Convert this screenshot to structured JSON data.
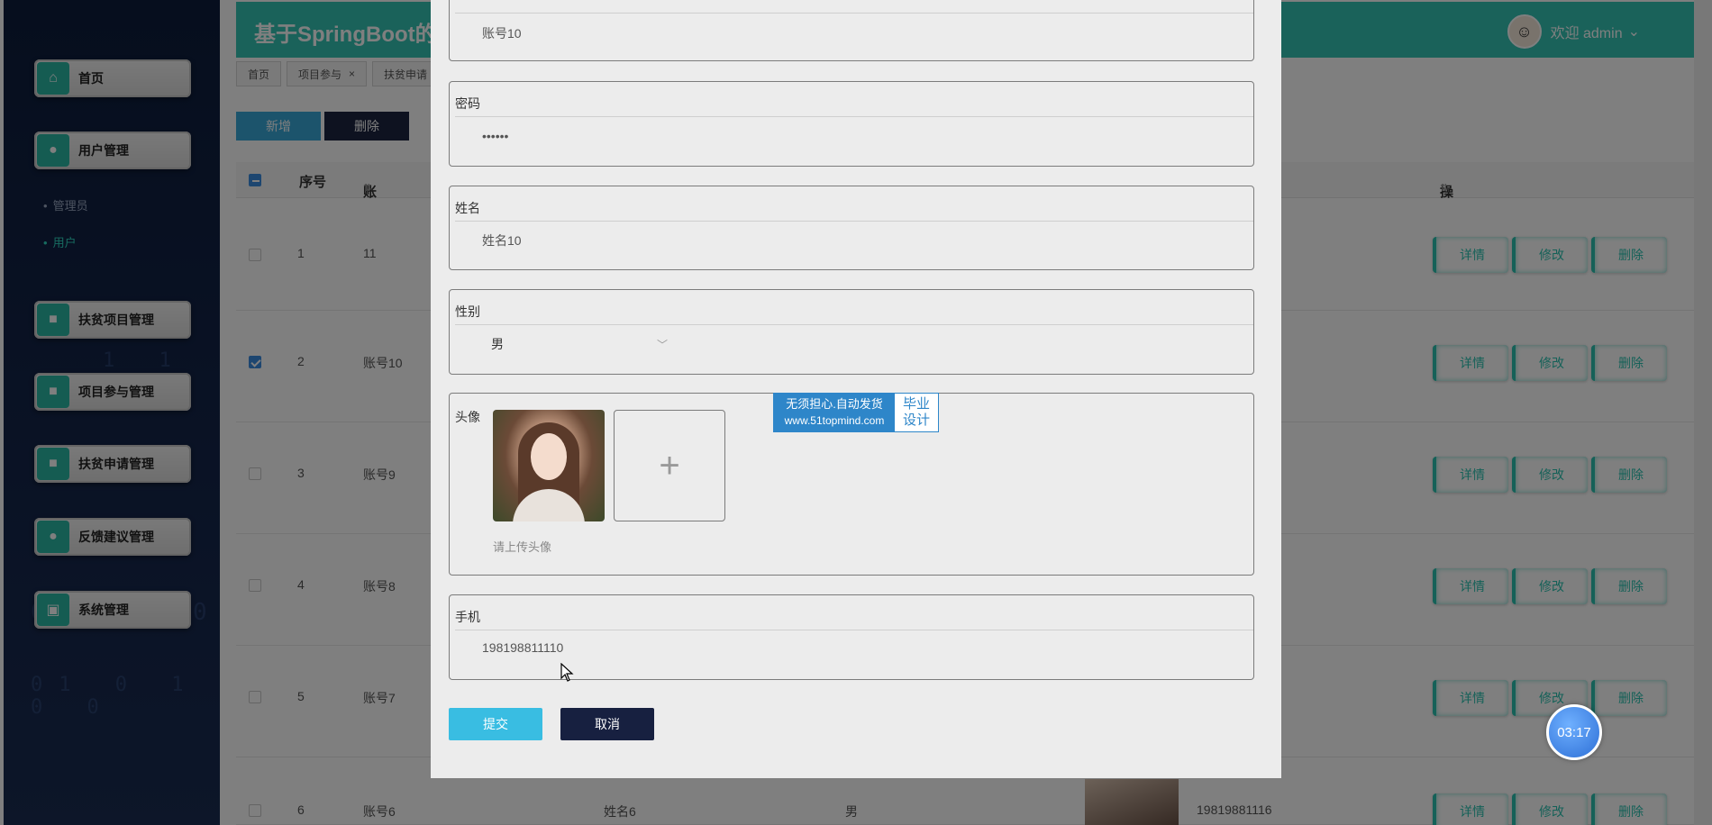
{
  "app": {
    "title": "基于SpringBoot的",
    "welcome": "欢迎 admin",
    "caret": "⌄"
  },
  "sidebar": {
    "menu": [
      {
        "label": "首页",
        "icon": "home-icon"
      },
      {
        "label": "用户管理",
        "icon": "user-icon"
      },
      {
        "label": "扶贫项目管理",
        "icon": "project-icon"
      },
      {
        "label": "项目参与管理",
        "icon": "participation-icon"
      },
      {
        "label": "扶贫申请管理",
        "icon": "application-icon"
      },
      {
        "label": "反馈建议管理",
        "icon": "feedback-icon"
      },
      {
        "label": "系统管理",
        "icon": "system-icon"
      }
    ],
    "submenu": [
      {
        "label": "管理员",
        "active": false
      },
      {
        "label": "用户",
        "active": true
      }
    ],
    "rain": [
      "1 1",
      "0",
      "01 0 1 0 0",
      "0"
    ]
  },
  "tabs": [
    {
      "label": "首页",
      "closable": false
    },
    {
      "label": "项目参与",
      "closable": true
    },
    {
      "label": "扶贫申请",
      "closable": false
    }
  ],
  "toolbar": {
    "add_label": "新增",
    "delete_label": "删除"
  },
  "table": {
    "headers": {
      "index": "序号",
      "account": "账号",
      "action": "操作"
    },
    "rows": [
      {
        "index": "1",
        "account": "11",
        "checked": false
      },
      {
        "index": "2",
        "account": "账号10",
        "checked": true
      },
      {
        "index": "3",
        "account": "账号9",
        "checked": false
      },
      {
        "index": "4",
        "account": "账号8",
        "checked": false
      },
      {
        "index": "5",
        "account": "账号7",
        "checked": false
      },
      {
        "index": "6",
        "account": "账号6",
        "name": "姓名6",
        "gender": "男",
        "phone": "19819881116",
        "checked": false
      }
    ],
    "actions": {
      "detail": "详情",
      "edit": "修改",
      "delete": "删除"
    }
  },
  "form": {
    "account": {
      "value": "账号10"
    },
    "password": {
      "label": "密码",
      "value": "••••••"
    },
    "name": {
      "label": "姓名",
      "value": "姓名10"
    },
    "gender": {
      "label": "性别",
      "value": "男"
    },
    "avatar": {
      "label": "头像",
      "tip": "请上传头像",
      "add": "+"
    },
    "phone": {
      "label": "手机",
      "value": "198198811110"
    },
    "submit_label": "提交",
    "cancel_label": "取消"
  },
  "watermark": {
    "line1": "无须担心.自动发货",
    "line2": "www.51topmind.com",
    "badge1": "毕业",
    "badge2": "设计"
  },
  "timer": "03:17"
}
